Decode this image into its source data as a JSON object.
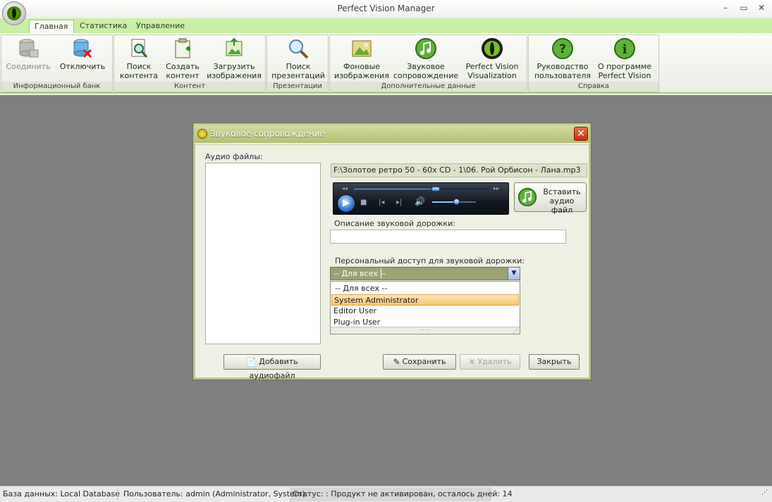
{
  "app": {
    "title": "Perfect Vision Manager"
  },
  "window_controls": {
    "minimize": "–",
    "maximize": "▭",
    "close": "✕"
  },
  "ribbon": {
    "tabs": [
      "Главная",
      "Статистика",
      "Управление"
    ],
    "groups": [
      {
        "label": "Информационный банк",
        "buttons": [
          {
            "line1": "Соединить",
            "line2": "",
            "icon": "database-connect-icon",
            "enabled": false
          },
          {
            "line1": "Отключить",
            "line2": "",
            "icon": "database-disconnect-icon",
            "enabled": true
          }
        ]
      },
      {
        "label": "Контент",
        "buttons": [
          {
            "line1": "Поиск",
            "line2": "контента",
            "icon": "search-document-icon"
          },
          {
            "line1": "Создать",
            "line2": "контент",
            "icon": "clipboard-new-icon"
          },
          {
            "line1": "Загрузить",
            "line2": "изображения",
            "icon": "image-upload-icon"
          }
        ]
      },
      {
        "label": "Презентации",
        "buttons": [
          {
            "line1": "Поиск",
            "line2": "презентаций",
            "icon": "magnifier-icon"
          }
        ]
      },
      {
        "label": "Дополнительные данные",
        "buttons": [
          {
            "line1": "Фоновые",
            "line2": "изображения",
            "icon": "background-image-icon"
          },
          {
            "line1": "Звуковое",
            "line2": "сопровождение",
            "icon": "music-note-icon"
          },
          {
            "line1": "Perfect Vision",
            "line2": "Visualization",
            "icon": "eye-icon"
          }
        ]
      },
      {
        "label": "Справка",
        "buttons": [
          {
            "line1": "Руководство",
            "line2": "пользователя",
            "icon": "help-icon"
          },
          {
            "line1": "О программе",
            "line2": "Perfect Vision",
            "icon": "info-icon"
          }
        ]
      }
    ]
  },
  "dialog": {
    "title": "Звуковое сопровождение",
    "audio_files_label": "Аудио файлы:",
    "file_path": "F:\\Золотое ретро 50 - 60х CD - 1\\06. Рой Орбисон - Лана.mp3",
    "player": {
      "seek_position": 0.6,
      "volume": 0.55
    },
    "insert_button": {
      "line1": "Вставить",
      "line2": "аудио файл"
    },
    "description_label": "Описание звуковой дорожки:",
    "description_value": "",
    "access_label": "Персональный доступ для звуковой дорожки:",
    "access_selected": "-- Для всех --",
    "access_options": [
      "-- Для всех --",
      "System Administrator",
      "Editor User",
      "Plug-in User"
    ],
    "access_highlighted_index": 1,
    "buttons": {
      "add": "Добавить аудиофайл",
      "save": "Сохранить",
      "delete": "Удалить",
      "close": "Закрыть"
    }
  },
  "statusbar": {
    "database": "База данных: Local Database",
    "user": "Пользователь: admin (Administrator, System).",
    "status": "Статус: : Продукт не активирован, осталось дней: 14"
  },
  "colors": {
    "ribbon_accent": "#9ed36a",
    "tab_strip": "#c9f0a4",
    "workspace": "#7f7f7f",
    "dialog_title": "#b3be74",
    "highlight": "#f7c66f"
  }
}
